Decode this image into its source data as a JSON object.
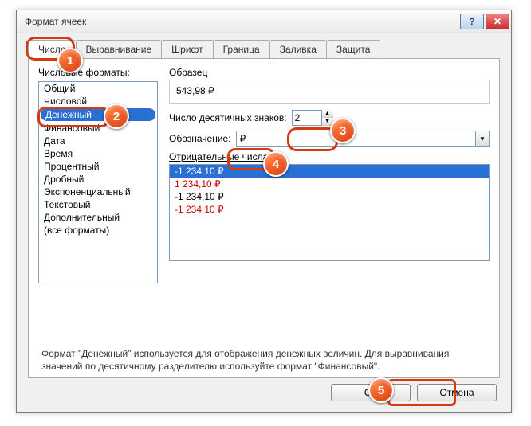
{
  "title": "Формат ячеек",
  "tabs": [
    "Число",
    "Выравнивание",
    "Шрифт",
    "Граница",
    "Заливка",
    "Защита"
  ],
  "activeTab": 0,
  "category_label": "Числовые форматы:",
  "categories": [
    "Общий",
    "Числовой",
    "Денежный",
    "Финансовый",
    "Дата",
    "Время",
    "Процентный",
    "Дробный",
    "Экспоненциальный",
    "Текстовый",
    "Дополнительный",
    "(все форматы)"
  ],
  "selectedCategoryIndex": 2,
  "sample_label": "Образец",
  "sample_value": "543,98 ₽",
  "decimal_label": "Число десятичных знаков:",
  "decimal_value": "2",
  "symbol_label": "Обозначение:",
  "symbol_value": "₽",
  "negative_label": "Отрицательные числа:",
  "negative_numbers": [
    {
      "text": "-1 234,10 ₽",
      "selected": true,
      "red": false
    },
    {
      "text": "1 234,10 ₽",
      "selected": false,
      "red": true
    },
    {
      "text": "-1 234,10 ₽",
      "selected": false,
      "red": false
    },
    {
      "text": "-1 234,10 ₽",
      "selected": false,
      "red": true
    }
  ],
  "description": "Формат \"Денежный\" используется для отображения денежных величин. Для выравнивания значений по десятичному разделителю используйте формат \"Финансовый\".",
  "buttons": {
    "ok": "ОК",
    "cancel": "Отмена"
  },
  "win": {
    "help": "?",
    "close": "✕"
  },
  "markers": [
    "1",
    "2",
    "3",
    "4",
    "5"
  ]
}
